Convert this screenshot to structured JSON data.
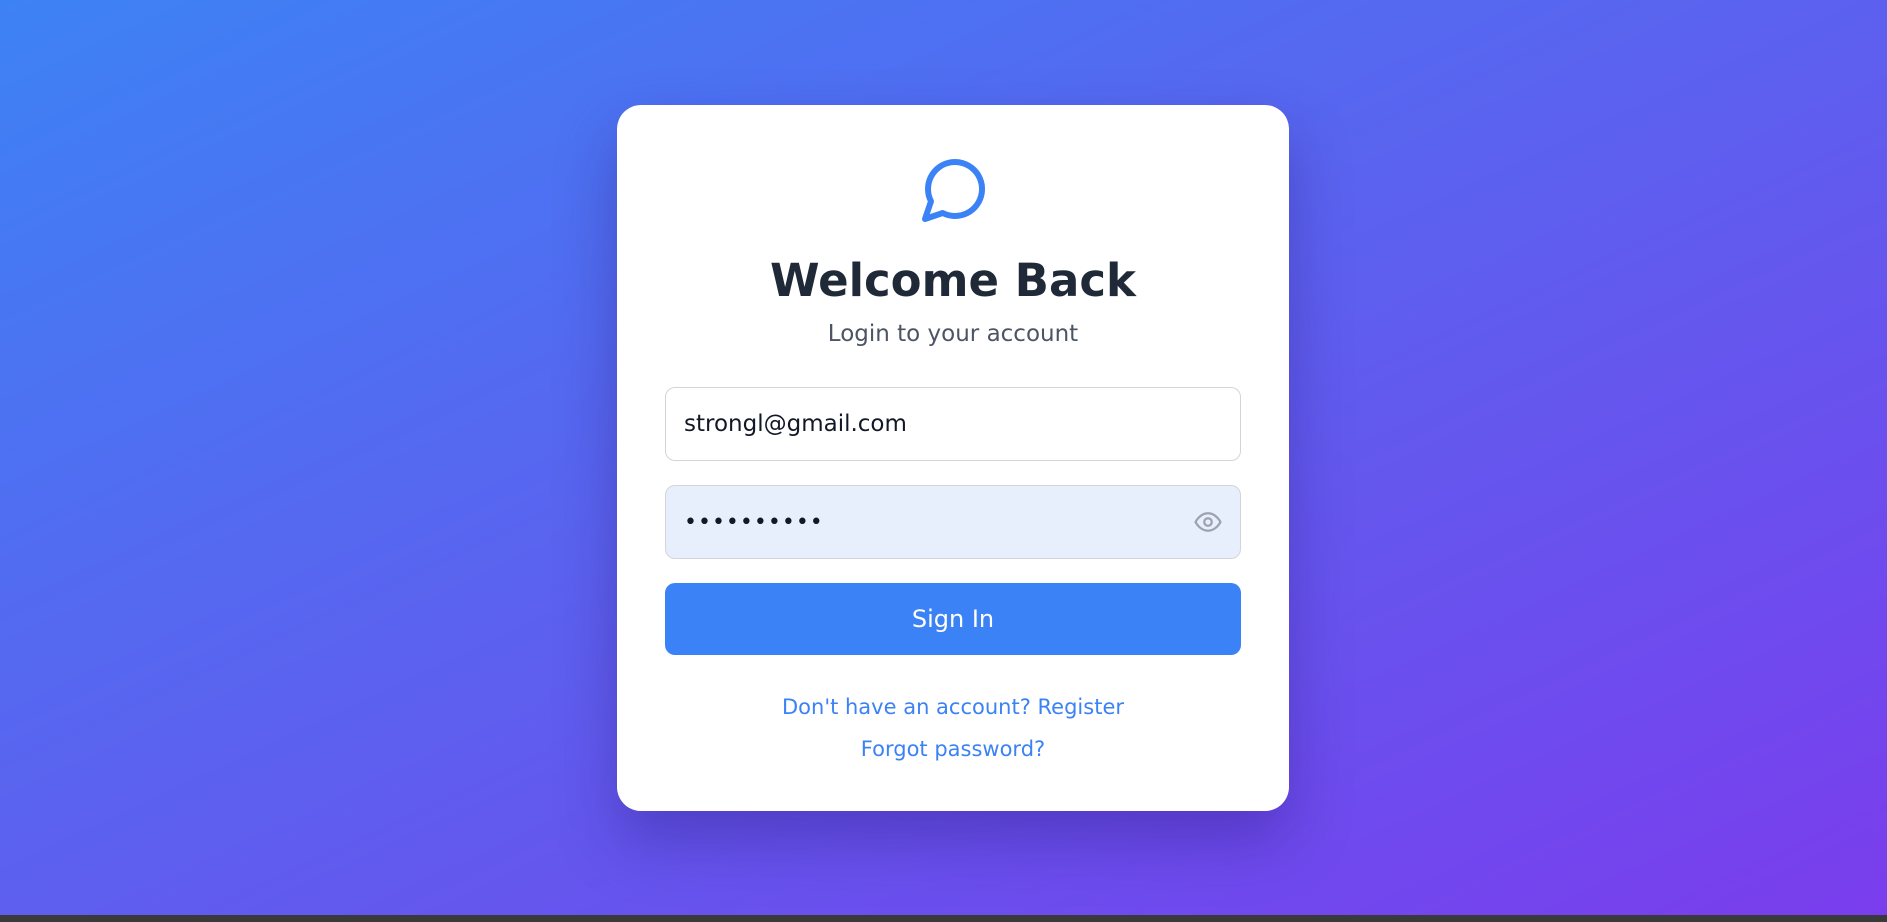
{
  "login": {
    "title": "Welcome Back",
    "subtitle": "Login to your account",
    "email_value": "strongl@gmail.com",
    "password_value": "••••••••••",
    "signin_label": "Sign In",
    "register_link": "Don't have an account? Register",
    "forgot_link": "Forgot password?",
    "logo_icon": "chat-bubble-icon",
    "show_password_icon": "eye-icon"
  },
  "colors": {
    "accent": "#3b82f6",
    "background_gradient_start": "#3d82f5",
    "background_gradient_end": "#7a3ded",
    "password_field_bg": "#e8effc",
    "title_text": "#1f2937"
  }
}
